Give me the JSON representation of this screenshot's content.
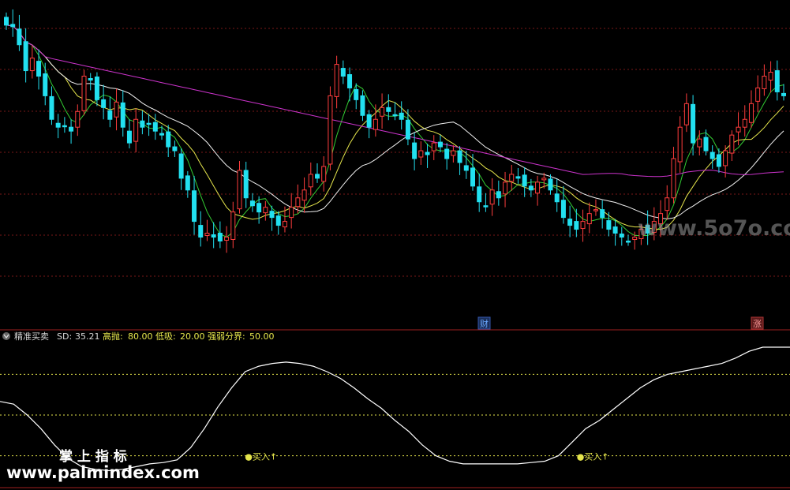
{
  "chart_data": [
    {
      "type": "candlestick",
      "panel": "price",
      "series": [
        {
          "name": "MA5",
          "color": "#33cc33"
        },
        {
          "name": "MA10",
          "color": "#e6e64c"
        },
        {
          "name": "MA20",
          "color": "#f0f0f0"
        },
        {
          "name": "MA60",
          "color": "#cc33cc"
        }
      ],
      "markers": [
        {
          "text": "财",
          "color": "#6aa8ff",
          "bg": "#1a2f5a"
        },
        {
          "text": "涨",
          "color": "#ff9a9a",
          "bg": "#5a1a1a"
        }
      ]
    },
    {
      "type": "line",
      "panel": "indicator",
      "name": "精准买卖",
      "fields": [
        {
          "label": "SD:",
          "value": "35.21",
          "color": "#d8d8d8"
        },
        {
          "label": "高抛:",
          "value": "80.00",
          "color": "#e6e64c"
        },
        {
          "label": "低吸:",
          "value": "20.00",
          "color": "#e6e64c"
        },
        {
          "label": "强弱分界:",
          "value": "50.00",
          "color": "#e6e64c"
        }
      ],
      "ref_lines": [
        80,
        50,
        20
      ],
      "ylim": [
        0,
        100
      ],
      "signals": [
        {
          "x": 0.31,
          "text": "●买入↑"
        },
        {
          "x": 0.73,
          "text": "●买入↑"
        }
      ],
      "sd": [
        60,
        58,
        50,
        40,
        28,
        18,
        12,
        10,
        9,
        10,
        12,
        14,
        15,
        17,
        26,
        40,
        56,
        70,
        82,
        86,
        88,
        89,
        88,
        86,
        82,
        77,
        70,
        62,
        55,
        46,
        38,
        28,
        20,
        16,
        14,
        14,
        14,
        14,
        14,
        15,
        16,
        20,
        30,
        40,
        46,
        54,
        62,
        70,
        76,
        80,
        82,
        84,
        86,
        88,
        92,
        97,
        100,
        100,
        100
      ]
    }
  ],
  "watermarks": {
    "site_top": "www.5o7o.com",
    "brand": "掌 上 指 标",
    "site_bottom": "www.palmindex.com"
  },
  "colors": {
    "up": "#ff3d3d",
    "down": "#22e0f0",
    "ma60": "#cc33cc",
    "grid": "#8b1a1a"
  }
}
